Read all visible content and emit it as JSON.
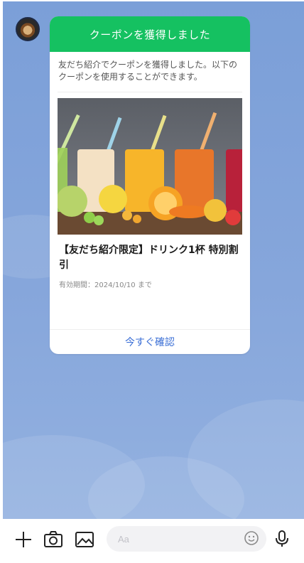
{
  "chat": {
    "message": {
      "header": "クーポンを獲得しました",
      "body": "友だち紹介でクーポンを獲得しました。以下のクーポンを使用することができます。",
      "coupon": {
        "title": "【友だち紹介限定】ドリンク1杯 特別割引",
        "expiry": "有効期間：2024/10/10 まで",
        "image_icon": "juice-glasses-photo"
      },
      "action_label": "今すぐ確認"
    }
  },
  "input_bar": {
    "placeholder": "Aa",
    "icons": [
      "plus-icon",
      "camera-icon",
      "image-icon",
      "emoji-icon",
      "mic-icon"
    ]
  },
  "colors": {
    "header_green": "#15c161",
    "link_blue": "#3b6fd6",
    "chat_background": "#7b9fd8"
  }
}
